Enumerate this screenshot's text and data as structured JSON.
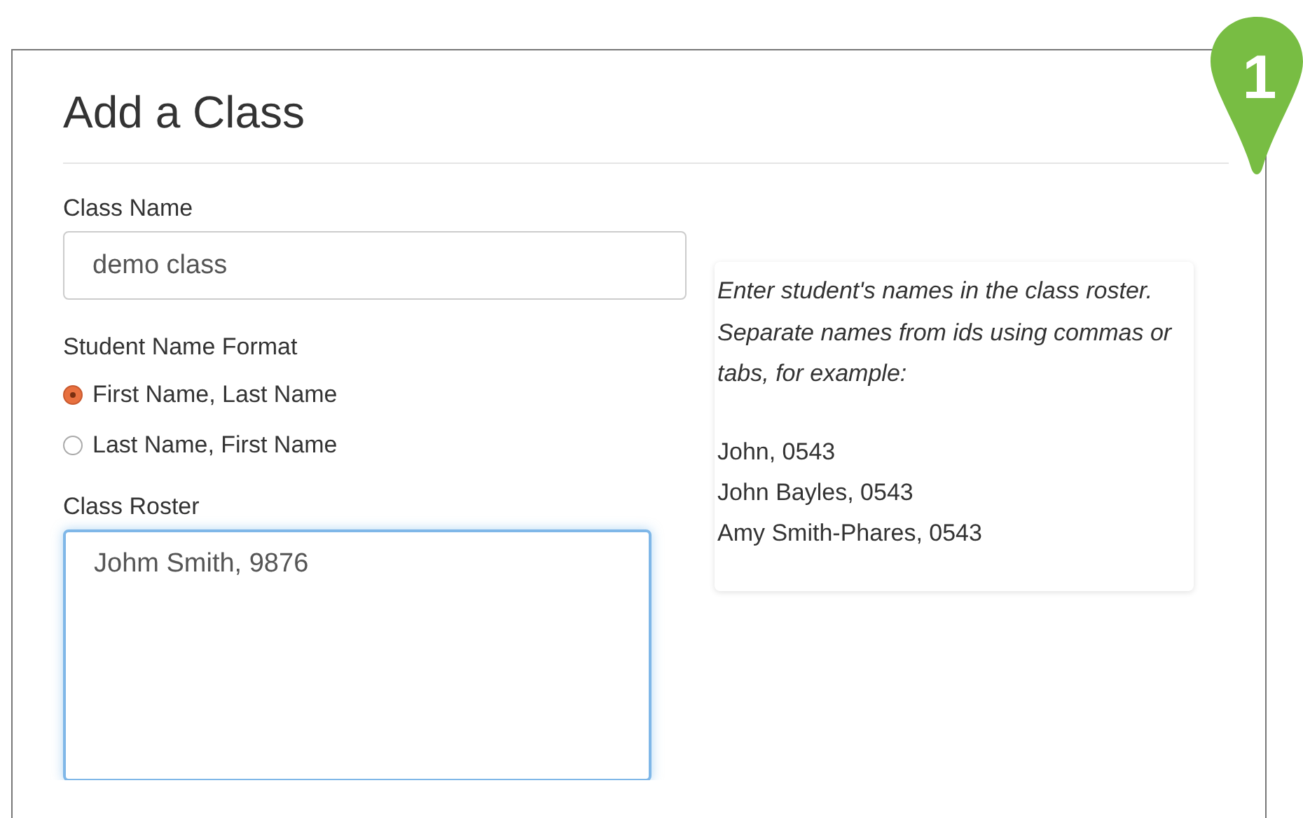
{
  "dialog": {
    "title": "Add a Class"
  },
  "class_name": {
    "label": "Class Name",
    "value": "demo class"
  },
  "name_format": {
    "label": "Student Name Format",
    "options": [
      {
        "label": "First Name, Last Name",
        "selected": true
      },
      {
        "label": "Last Name, First Name",
        "selected": false
      }
    ]
  },
  "roster": {
    "label": "Class Roster",
    "value": "Johm Smith, 9876"
  },
  "help": {
    "intro": "Enter student's names in the class roster. Separate names from ids using commas or tabs, for example:",
    "examples": [
      "John, 0543",
      "John Bayles, 0543",
      "Amy Smith-Phares, 0543"
    ]
  },
  "step_badge": {
    "number": "1"
  }
}
